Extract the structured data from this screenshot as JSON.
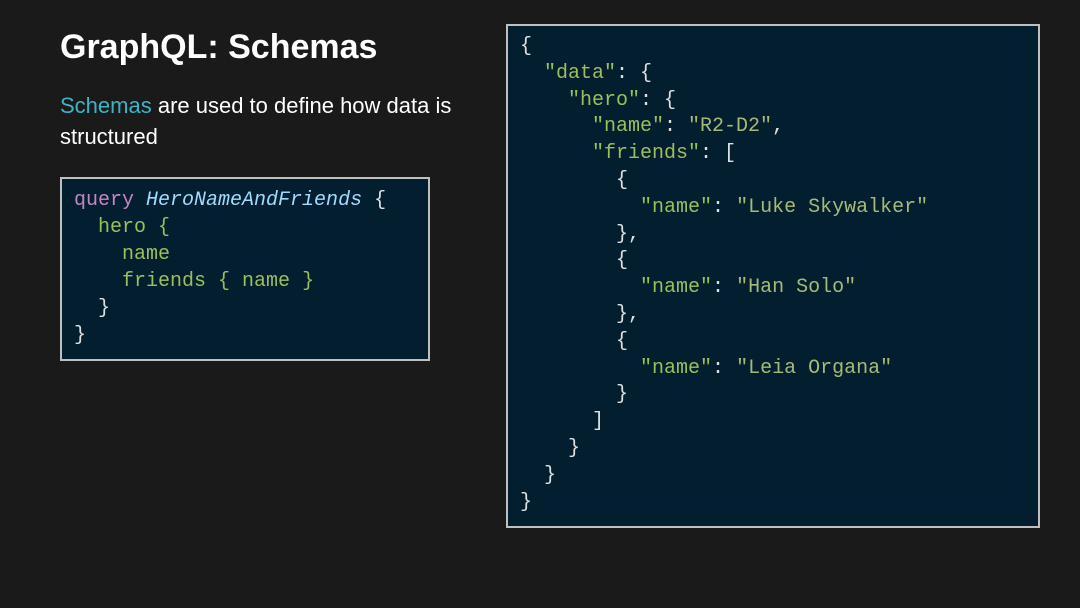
{
  "slide": {
    "title": "GraphQL: Schemas",
    "description_highlight": "Schemas",
    "description_rest": " are used to define how data is structured"
  },
  "query_code": {
    "keyword": "query",
    "operation_name": "HeroNameAndFriends",
    "open_brace": "{",
    "line_hero": "hero {",
    "line_name": "name",
    "line_friends_open": "friends { ",
    "line_friends_name": "name",
    "line_friends_close": " }",
    "line_close_inner": "}",
    "line_close_outer": "}"
  },
  "response_code": {
    "l1": "{",
    "l2_key": "\"data\"",
    "l2_rest": ": {",
    "l3_key": "\"hero\"",
    "l3_rest": ": {",
    "l4_key": "\"name\"",
    "l4_mid": ": ",
    "l4_val": "\"R2-D2\"",
    "l4_end": ",",
    "l5_key": "\"friends\"",
    "l5_rest": ": [",
    "l6": "{",
    "l7_key": "\"name\"",
    "l7_mid": ": ",
    "l7_val": "\"Luke Skywalker\"",
    "l8": "},",
    "l9": "{",
    "l10_key": "\"name\"",
    "l10_mid": ": ",
    "l10_val": "\"Han Solo\"",
    "l11": "},",
    "l12": "{",
    "l13_key": "\"name\"",
    "l13_mid": ": ",
    "l13_val": "\"Leia Organa\"",
    "l14": "}",
    "l15": "]",
    "l16": "}",
    "l17": "}",
    "l18": "}"
  }
}
